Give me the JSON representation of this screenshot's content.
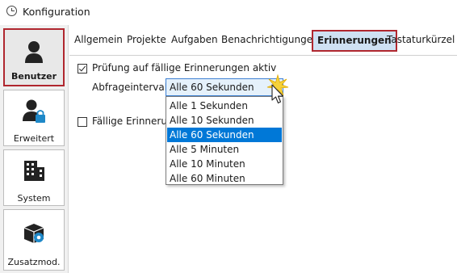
{
  "window": {
    "title": "Konfiguration",
    "icon": "clock-icon"
  },
  "sidebar": {
    "items": [
      {
        "label": "Benutzer",
        "icon": "user-icon",
        "active": true
      },
      {
        "label": "Erweitert",
        "icon": "user-lock-icon",
        "active": false
      },
      {
        "label": "System",
        "icon": "building-icon",
        "active": false
      },
      {
        "label": "Zusatzmod.",
        "icon": "package-gear-icon",
        "active": false
      }
    ]
  },
  "tabs": [
    {
      "label": "Allgemein"
    },
    {
      "label": "Projekte"
    },
    {
      "label": "Aufgaben"
    },
    {
      "label": "Benachrichtigungen"
    },
    {
      "label": "Erinnerungen",
      "active": true
    },
    {
      "label": "Tastaturkürzel"
    }
  ],
  "reminders": {
    "check_label": "Prüfung auf fällige Erinnerungen aktiv",
    "check_checked": true,
    "interval_label": "Abfrageintervall",
    "interval_value": "Alle 60 Sekunden",
    "second_check_label": "Fällige Erinnerung",
    "second_check_checked": false
  },
  "dropdown": {
    "options": [
      "Alle 1 Sekunden",
      "Alle 10 Sekunden",
      "Alle 60 Sekunden",
      "Alle 5 Minuten",
      "Alle 10 Minuten",
      "Alle 60 Minuten"
    ],
    "selected_index": 2
  },
  "colors": {
    "accent_border": "#b0272f",
    "selection": "#0078d7",
    "active_tab_bg": "#cfe1f3"
  }
}
